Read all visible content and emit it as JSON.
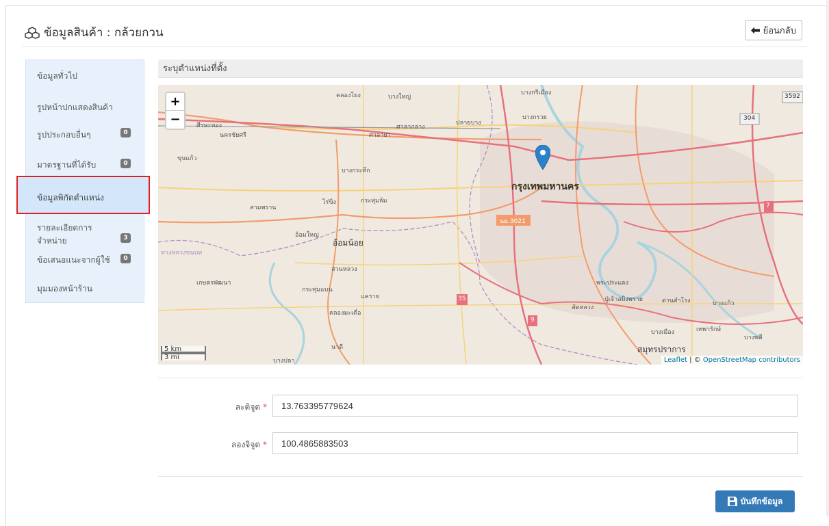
{
  "header": {
    "title": "ข้อมูลสินค้า : กล้วยกวน",
    "back_label": "ย้อนกลับ"
  },
  "sidebar": {
    "items": [
      {
        "label": "ข้อมูลทั่วไป"
      },
      {
        "label": "รูปหน้าปกแสดงสินค้า"
      },
      {
        "label": "รูปประกอบอื่นๆ",
        "badge": "0"
      },
      {
        "label": "มาตรฐานที่ได้รับ",
        "badge": "0"
      },
      {
        "label": "ข้อมูลพิกัดตำแหน่ง",
        "active": true
      },
      {
        "label": "รายละเอียดการจำหน่าย",
        "badge": "3"
      },
      {
        "label": "ข้อเสนอแนะจากผู้ใช้",
        "badge": "0"
      },
      {
        "label": "มุมมองหน้าร้าน"
      }
    ]
  },
  "section": {
    "title": "ระบุตำแหน่งที่ตั้ง"
  },
  "map": {
    "zoom_in": "+",
    "zoom_out": "−",
    "scale_km": "5 km",
    "scale_mi": "3 mi",
    "attribution_leaflet": "Leaflet",
    "attribution_sep": " | © ",
    "attribution_osm": "OpenStreetMap contributors",
    "place_labels": [
      "คลองโยง",
      "บางใหญ่",
      "บางกรวย",
      "ศาลากลาง",
      "ปลายบาง",
      "ศาลายา",
      "นครชัยศรี",
      "ศีรษะทอง",
      "ขุนแก้ว",
      "บางกระทึก",
      "กรุงเทพมหานคร",
      "ไร่ขิง",
      "กระทุ่มล้ม",
      "สามพราน",
      "อ้อมใหญ่",
      "อ้อมน้อย",
      "สวนหลวง",
      "เกษตรพัฒนา",
      "กระทุ่มแบน",
      "แคราย",
      "คลองมะเดื่อ",
      "นาดี",
      "บางปลา",
      "พระประแดง",
      "ปู่เจ้าสมิงพราย",
      "ด่านสำโรง",
      "บางแก้ว",
      "สัดหลวง",
      "บางเมือง",
      "เทพารักษ์",
      "บางพลี",
      "สมุทรปราการ",
      "บางกรีเมือง",
      "ทางหลวงชนบท",
      "ทม.3021"
    ],
    "road_shields": [
      "3592",
      "304",
      "7",
      "35",
      "9",
      "นม.3021"
    ],
    "marker_color": "#2b82cb"
  },
  "form": {
    "lat_label": "ละติจูด",
    "lat_value": "13.763395779624",
    "lng_label": "ลองจิจูด",
    "lng_value": "100.4865883503",
    "required_mark": "*"
  },
  "actions": {
    "save_label": "บันทึกข้อมูล"
  },
  "colors": {
    "primary": "#337ab7",
    "sidebar_bg": "#e8f1fb",
    "highlight_border": "#e0201f"
  }
}
